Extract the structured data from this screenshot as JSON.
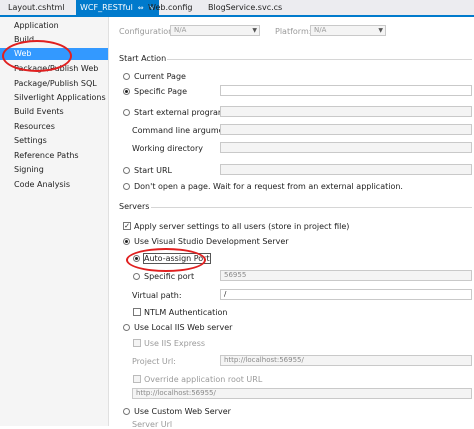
{
  "tabs": [
    {
      "label": "Layout.cshtml"
    },
    {
      "label": "WCF_RESTful",
      "pin": "⇔",
      "close": "×"
    },
    {
      "label": "Web.config"
    },
    {
      "label": "BlogService.svc.cs"
    }
  ],
  "sidebar": {
    "items": [
      {
        "label": "Application"
      },
      {
        "label": "Build"
      },
      {
        "label": "Web"
      },
      {
        "label": "Package/Publish Web"
      },
      {
        "label": "Package/Publish SQL"
      },
      {
        "label": "Silverlight Applications"
      },
      {
        "label": "Build Events"
      },
      {
        "label": "Resources"
      },
      {
        "label": "Settings"
      },
      {
        "label": "Reference Paths"
      },
      {
        "label": "Signing"
      },
      {
        "label": "Code Analysis"
      }
    ]
  },
  "config": {
    "configuration_label": "Configuration:",
    "configuration_value": "N/A",
    "platform_label": "Platform:",
    "platform_value": "N/A"
  },
  "start_action": {
    "title": "Start Action",
    "current_page": "Current Page",
    "specific_page": "Specific Page",
    "start_external_program": "Start external program",
    "command_line_arguments": "Command line arguments",
    "working_directory": "Working directory",
    "start_url": "Start URL",
    "dont_open": "Don't open a page.  Wait for a request from an external application."
  },
  "servers": {
    "title": "Servers",
    "apply_settings": "Apply server settings to all users (store in project file)",
    "use_vs_dev_server": "Use Visual Studio Development Server",
    "auto_assign_port": "Auto-assign Port",
    "specific_port": "Specific port",
    "specific_port_value": "56955",
    "virtual_path_label": "Virtual path:",
    "virtual_path_value": "/",
    "ntlm": "NTLM Authentication",
    "use_local_iis": "Use Local IIS Web server",
    "use_iis_express": "Use IIS Express",
    "project_url_label": "Project Url:",
    "project_url_value": "http://localhost:56955/",
    "override_root_url": "Override application root URL",
    "override_root_value": "http://localhost:56955/",
    "use_custom_server": "Use Custom Web Server",
    "server_url_label": "Server Url"
  },
  "colors": {
    "accent": "#007acc",
    "selection": "#3399ff",
    "annotation": "#e02020"
  }
}
